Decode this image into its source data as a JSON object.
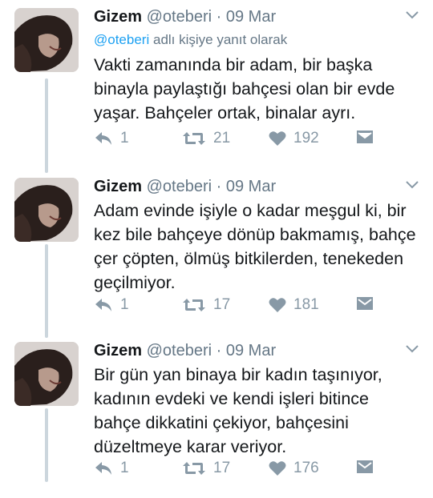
{
  "tweets": [
    {
      "name": "Gizem",
      "handle": "@oteberi",
      "separator": "·",
      "date": "09 Mar",
      "reply_mention": "@oteberi",
      "reply_suffix": "adlı kişiye yanıt olarak",
      "text": "Vakti zamanında bir adam, bir başka\nbinayla paylaştığı bahçesi olan bir evde\nyaşar. Bahçeler ortak,  binalar ayrı.",
      "replies": "1",
      "retweets": "21",
      "likes": "192"
    },
    {
      "name": "Gizem",
      "handle": "@oteberi",
      "separator": "·",
      "date": "09 Mar",
      "text": "Adam evinde işiyle o kadar meşgul ki, bir\nkez bile bahçeye dönüp bakmamış, bahçe\nçer çöpten, ölmüş bitkilerden, tenekeden\ngeçilmiyor.",
      "replies": "1",
      "retweets": "17",
      "likes": "181"
    },
    {
      "name": "Gizem",
      "handle": "@oteberi",
      "separator": "·",
      "date": "09 Mar",
      "text": "Bir gün yan binaya bir kadın taşınıyor,\nkadının evdeki ve kendi işleri bitince\nbahçe dikkatini çekiyor, bahçesini\ndüzeltmeye karar veriyor.",
      "replies": "1",
      "retweets": "17",
      "likes": "176"
    }
  ],
  "icons": {
    "reply": "reply-icon",
    "retweet": "retweet-icon",
    "like": "heart-icon",
    "message": "envelope-icon",
    "more": "chevron-down-icon"
  },
  "colors": {
    "name": "#14171a",
    "secondary": "#657786",
    "mention": "#1da1f2",
    "action": "#8899a6",
    "thread_line": "#ccd6dd"
  }
}
